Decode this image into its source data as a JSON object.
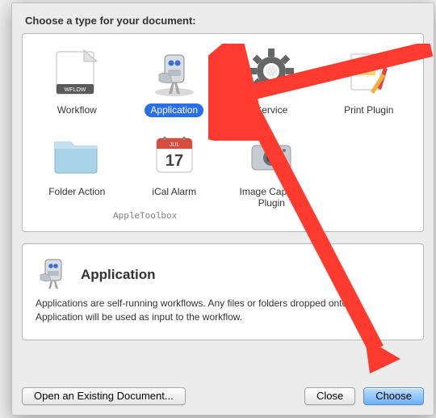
{
  "prompt": "Choose a type for your document:",
  "types": [
    {
      "label": "Workflow",
      "icon": "wflow-icon"
    },
    {
      "label": "Application",
      "icon": "automator-app-icon",
      "selected": true
    },
    {
      "label": "Service",
      "icon": "gear-icon"
    },
    {
      "label": "Print Plugin",
      "icon": "print-icon"
    },
    {
      "label": "Folder Action",
      "icon": "folder-icon"
    },
    {
      "label": "iCal Alarm",
      "icon": "ical-icon"
    },
    {
      "label": "Image Capture Plugin",
      "icon": "camera-icon"
    }
  ],
  "watermark": "AppleToolbox",
  "description": {
    "title": "Application",
    "text": "Applications are self-running workflows. Any files or folders dropped onto an Application will be used as input to the workflow."
  },
  "buttons": {
    "open": "Open an Existing Document...",
    "close": "Close",
    "choose": "Choose"
  }
}
